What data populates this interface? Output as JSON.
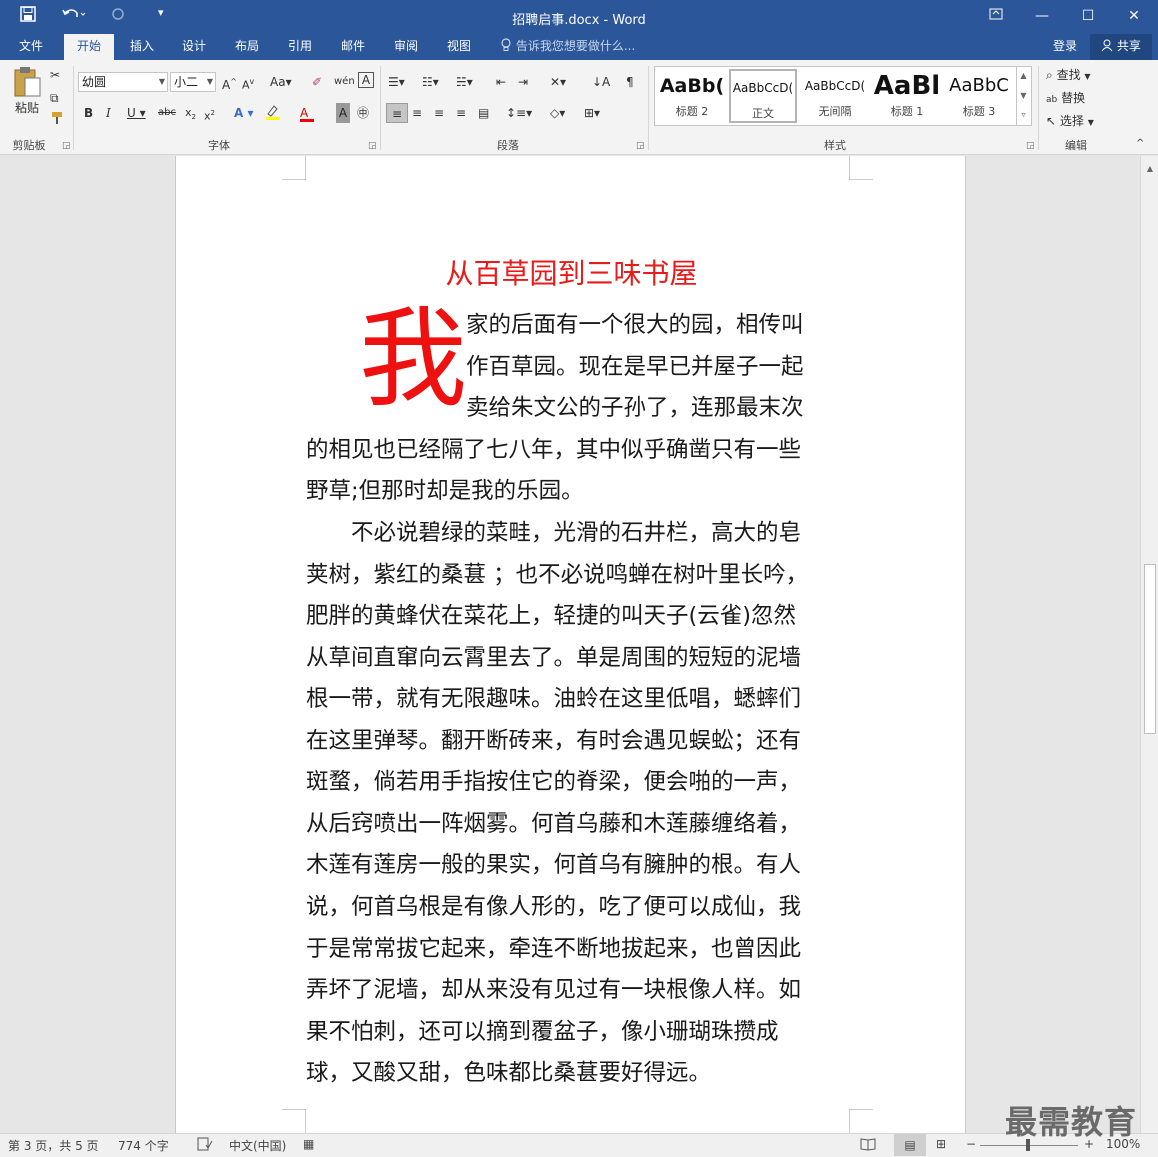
{
  "titlebar": {
    "title": "招聘启事.docx - Word",
    "save_icon": "save-icon",
    "undo_icon": "undo-icon",
    "redo_icon": "redo-icon",
    "customize_icon": "customize-icon"
  },
  "tabs": [
    {
      "label": "文件"
    },
    {
      "label": "开始"
    },
    {
      "label": "插入"
    },
    {
      "label": "设计"
    },
    {
      "label": "布局"
    },
    {
      "label": "引用"
    },
    {
      "label": "邮件"
    },
    {
      "label": "审阅"
    },
    {
      "label": "视图"
    }
  ],
  "tell_me": "告诉我您想要做什么...",
  "login": "登录",
  "share": "共享",
  "ribbon": {
    "clipboard": {
      "paste_label": "粘贴",
      "group_label": "剪贴板"
    },
    "font": {
      "font_name": "幼圆",
      "font_size": "小二",
      "group_label": "字体"
    },
    "paragraph": {
      "group_label": "段落"
    },
    "styles": {
      "group_label": "样式",
      "items": [
        {
          "preview": "AaBb(",
          "name": "标题 2"
        },
        {
          "preview": "AaBbCcD(",
          "name": "正文"
        },
        {
          "preview": "AaBbCcD(",
          "name": "无间隔"
        },
        {
          "preview": "AaBl",
          "name": "标题 1"
        },
        {
          "preview": "AaBbC",
          "name": "标题 3"
        }
      ]
    },
    "editing": {
      "find": "查找",
      "replace": "替换",
      "select": "选择",
      "group_label": "编辑"
    }
  },
  "document": {
    "title": "从百草园到三味书屋",
    "dropcap": "我",
    "lines": [
      "家的后面有一个很大的园，相传叫",
      "作百草园。现在是早已并屋子一起",
      "卖给朱文公的子孙了，连那最末次",
      "的相见也已经隔了七八年，其中似乎确凿只有一些",
      "野草;但那时却是我的乐园。",
      "　　不必说碧绿的菜畦，光滑的石井栏，高大的皂",
      "荚树，紫红的桑葚 ；也不必说鸣蝉在树叶里长吟，",
      "肥胖的黄蜂伏在菜花上，轻捷的叫天子(云雀)忽然",
      "从草间直窜向云霄里去了。单是周围的短短的泥墙",
      "根一带，就有无限趣味。油蛉在这里低唱，蟋蟀们",
      "在这里弹琴。翻开断砖来，有时会遇见蜈蚣；还有",
      "斑蝥，倘若用手指按住它的脊梁，便会啪的一声，",
      "从后窍喷出一阵烟雾。何首乌藤和木莲藤缠络着，",
      "木莲有莲房一般的果实，何首乌有臃肿的根。有人",
      "说，何首乌根是有像人形的，吃了便可以成仙，我",
      "于是常常拔它起来，牵连不断地拔起来，也曾因此",
      "弄坏了泥墙，却从来没有见过有一块根像人样。如",
      "果不怕刺，还可以摘到覆盆子，像小珊瑚珠攒成",
      "球，又酸又甜，色味都比桑葚要好得远。"
    ]
  },
  "status": {
    "page": "第 3 页，共 5 页",
    "words": "774 个字",
    "language": "中文(中国)",
    "zoom": "100%"
  },
  "watermark": "最需教育",
  "colors": {
    "accent": "#2b579a",
    "title_red": "#e81a1a"
  }
}
